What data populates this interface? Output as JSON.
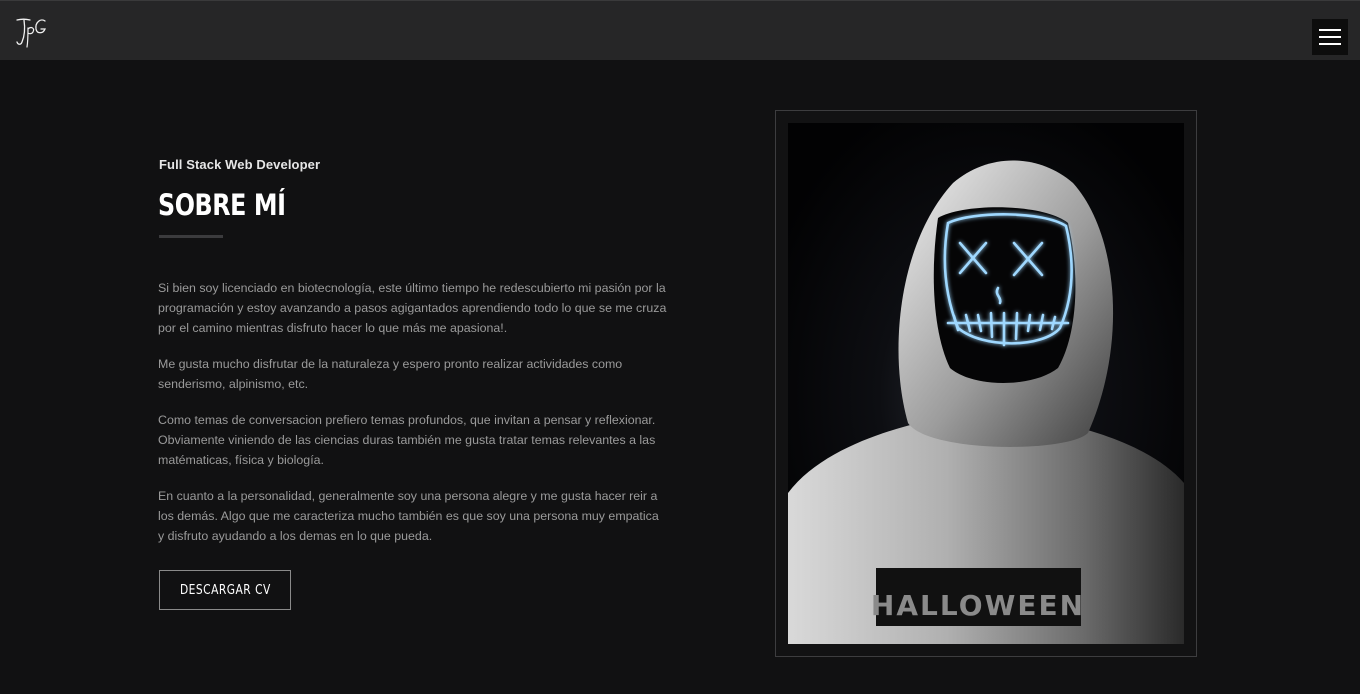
{
  "header": {
    "logo_text": "JpG",
    "menu_icon": "hamburger-menu-icon"
  },
  "about": {
    "subtitle": "Full Stack Web Developer",
    "title": "SOBRE MÍ",
    "paragraphs": [
      "Si bien soy licenciado en biotecnología, este último tiempo he redescubierto mi pasión por la programación y estoy avanzando a pasos agigantados aprendiendo todo lo que se me cruza por el camino mientras disfruto hacer lo que más me apasiona!.",
      "Me gusta mucho disfrutar de la naturaleza y espero pronto realizar actividades como senderismo, alpinismo, etc.",
      "Como temas de conversacion prefiero temas profundos, que invitan a pensar y reflexionar. Obviamente viniendo de las ciencias duras también me gusta tratar temas relevantes a las matématicas, física y biología.",
      "En cuanto a la personalidad, generalmente soy una persona alegre y me gusta hacer reir a los demás. Algo que me caracteriza mucho también es que soy una persona muy empatica y disfruto ayudando a los demas en lo que pueda."
    ],
    "cv_button_label": "DESCARGAR CV"
  },
  "photo": {
    "subject": "person in white hoodie wearing a glowing LED mask",
    "shirt_text": "HALLOWEEN"
  },
  "colors": {
    "background": "#111112",
    "header": "#262627",
    "mask_glow": "#9fd8ff",
    "text_muted": "#9a9a9a"
  }
}
